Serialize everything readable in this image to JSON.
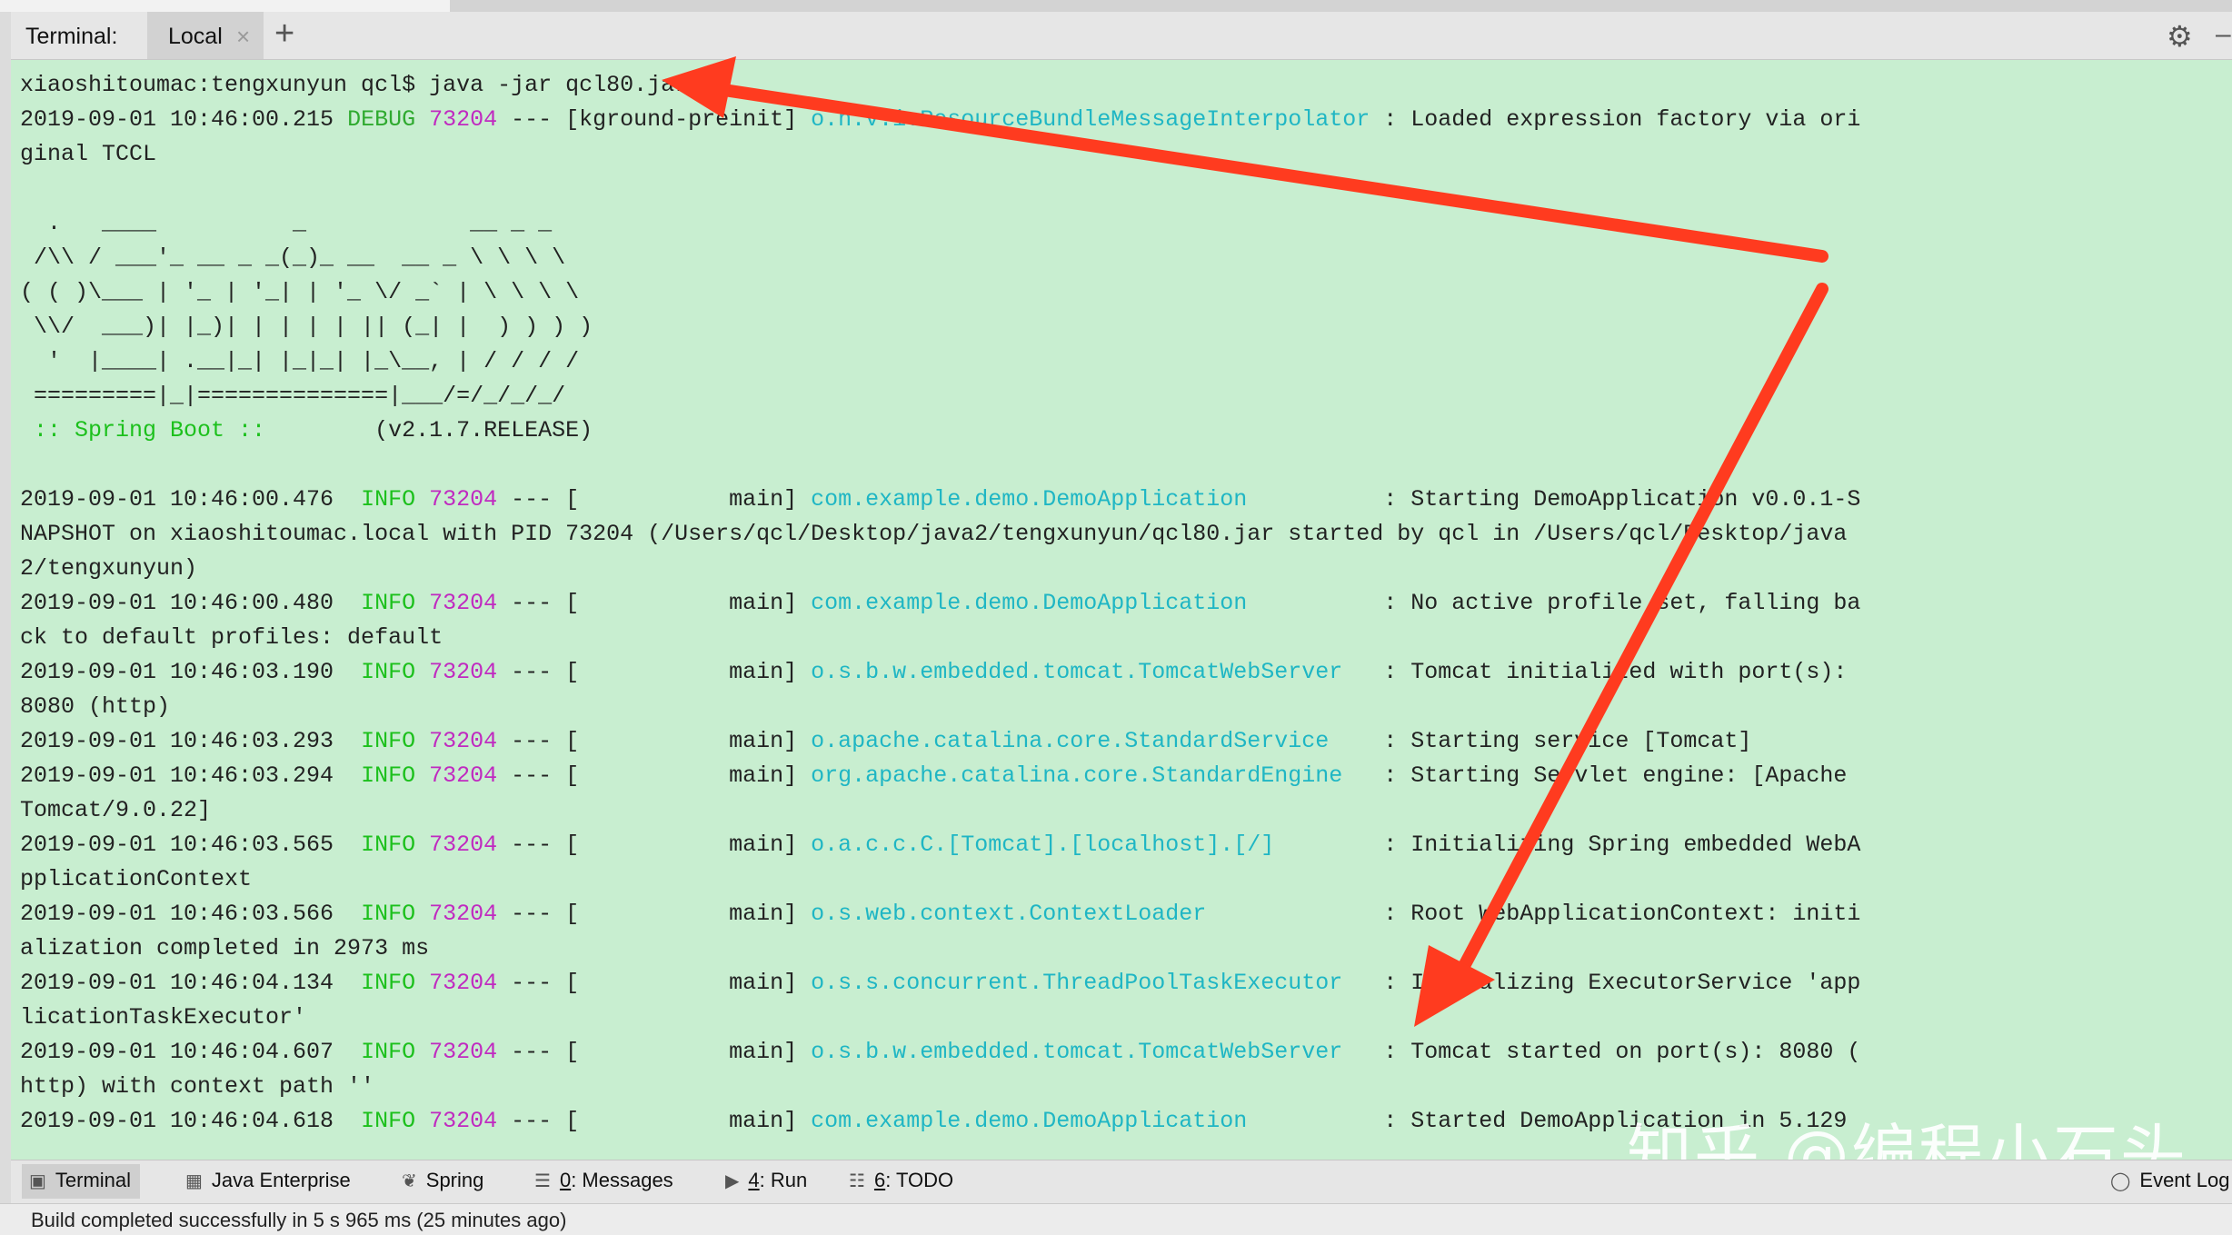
{
  "header": {
    "terminal_label": "Terminal:",
    "tab_local": "Local",
    "tab_close": "×",
    "add_tab": "+",
    "settings_icon": "⚙",
    "minimize": "–"
  },
  "terminal": {
    "lines": [
      [
        {
          "t": "xiaoshitoumac:tengxunyun qcl$ java -jar qcl80.jar"
        }
      ],
      [
        {
          "t": "2019-09-01 10:46:00.215 "
        },
        {
          "t": "DEBUG",
          "c": "c-debug"
        },
        {
          "t": " "
        },
        {
          "t": "73204",
          "c": "c-pid"
        },
        {
          "t": " --- [kground-preinit] "
        },
        {
          "t": "o.h.v.i.ResourceBundleMessageInterpolator",
          "c": "c-log"
        },
        {
          "t": " : Loaded expression factory via ori"
        }
      ],
      [
        {
          "t": "ginal TCCL"
        }
      ],
      [
        {
          "t": ""
        }
      ],
      [
        {
          "t": "  .   ____          _            __ _ _"
        }
      ],
      [
        {
          "t": " /\\\\ / ___'_ __ _ _(_)_ __  __ _ \\ \\ \\ \\"
        }
      ],
      [
        {
          "t": "( ( )\\___ | '_ | '_| | '_ \\/ _` | \\ \\ \\ \\"
        }
      ],
      [
        {
          "t": " \\\\/  ___)| |_)| | | | | || (_| |  ) ) ) )"
        }
      ],
      [
        {
          "t": "  '  |____| .__|_| |_|_| |_\\__, | / / / /"
        }
      ],
      [
        {
          "t": " =========|_|==============|___/=/_/_/_/"
        }
      ],
      [
        {
          "t": " :: Spring Boot ::",
          "c": "c-boot"
        },
        {
          "t": "        (v2.1.7.RELEASE)"
        }
      ],
      [
        {
          "t": ""
        }
      ],
      [
        {
          "t": "2019-09-01 10:46:00.476  "
        },
        {
          "t": "INFO",
          "c": "c-info"
        },
        {
          "t": " "
        },
        {
          "t": "73204",
          "c": "c-pid"
        },
        {
          "t": " --- [           main] "
        },
        {
          "t": "com.example.demo.DemoApplication",
          "c": "c-log"
        },
        {
          "t": "          : Starting DemoApplication v0.0.1-S"
        }
      ],
      [
        {
          "t": "NAPSHOT on xiaoshitoumac.local with PID 73204 (/Users/qcl/Desktop/java2/tengxunyun/qcl80.jar started by qcl in /Users/qcl/Desktop/java"
        }
      ],
      [
        {
          "t": "2/tengxunyun)"
        }
      ],
      [
        {
          "t": "2019-09-01 10:46:00.480  "
        },
        {
          "t": "INFO",
          "c": "c-info"
        },
        {
          "t": " "
        },
        {
          "t": "73204",
          "c": "c-pid"
        },
        {
          "t": " --- [           main] "
        },
        {
          "t": "com.example.demo.DemoApplication",
          "c": "c-log"
        },
        {
          "t": "          : No active profile set, falling ba"
        }
      ],
      [
        {
          "t": "ck to default profiles: default"
        }
      ],
      [
        {
          "t": "2019-09-01 10:46:03.190  "
        },
        {
          "t": "INFO",
          "c": "c-info"
        },
        {
          "t": " "
        },
        {
          "t": "73204",
          "c": "c-pid"
        },
        {
          "t": " --- [           main] "
        },
        {
          "t": "o.s.b.w.embedded.tomcat.TomcatWebServer",
          "c": "c-log"
        },
        {
          "t": "   : Tomcat initialized with port(s):"
        }
      ],
      [
        {
          "t": "8080 (http)"
        }
      ],
      [
        {
          "t": "2019-09-01 10:46:03.293  "
        },
        {
          "t": "INFO",
          "c": "c-info"
        },
        {
          "t": " "
        },
        {
          "t": "73204",
          "c": "c-pid"
        },
        {
          "t": " --- [           main] "
        },
        {
          "t": "o.apache.catalina.core.StandardService",
          "c": "c-log"
        },
        {
          "t": "    : Starting service [Tomcat]"
        }
      ],
      [
        {
          "t": "2019-09-01 10:46:03.294  "
        },
        {
          "t": "INFO",
          "c": "c-info"
        },
        {
          "t": " "
        },
        {
          "t": "73204",
          "c": "c-pid"
        },
        {
          "t": " --- [           main] "
        },
        {
          "t": "org.apache.catalina.core.StandardEngine",
          "c": "c-log"
        },
        {
          "t": "   : Starting Servlet engine: [Apache"
        }
      ],
      [
        {
          "t": "Tomcat/9.0.22]"
        }
      ],
      [
        {
          "t": "2019-09-01 10:46:03.565  "
        },
        {
          "t": "INFO",
          "c": "c-info"
        },
        {
          "t": " "
        },
        {
          "t": "73204",
          "c": "c-pid"
        },
        {
          "t": " --- [           main] "
        },
        {
          "t": "o.a.c.c.C.[Tomcat].[localhost].[/]",
          "c": "c-log"
        },
        {
          "t": "        : Initializing Spring embedded WebA"
        }
      ],
      [
        {
          "t": "pplicationContext"
        }
      ],
      [
        {
          "t": "2019-09-01 10:46:03.566  "
        },
        {
          "t": "INFO",
          "c": "c-info"
        },
        {
          "t": " "
        },
        {
          "t": "73204",
          "c": "c-pid"
        },
        {
          "t": " --- [           main] "
        },
        {
          "t": "o.s.web.context.ContextLoader",
          "c": "c-log"
        },
        {
          "t": "             : Root WebApplicationContext: initi"
        }
      ],
      [
        {
          "t": "alization completed in 2973 ms"
        }
      ],
      [
        {
          "t": "2019-09-01 10:46:04.134  "
        },
        {
          "t": "INFO",
          "c": "c-info"
        },
        {
          "t": " "
        },
        {
          "t": "73204",
          "c": "c-pid"
        },
        {
          "t": " --- [           main] "
        },
        {
          "t": "o.s.s.concurrent.ThreadPoolTaskExecutor",
          "c": "c-log"
        },
        {
          "t": "   : Initializing ExecutorService 'app"
        }
      ],
      [
        {
          "t": "licationTaskExecutor'"
        }
      ],
      [
        {
          "t": "2019-09-01 10:46:04.607  "
        },
        {
          "t": "INFO",
          "c": "c-info"
        },
        {
          "t": " "
        },
        {
          "t": "73204",
          "c": "c-pid"
        },
        {
          "t": " --- [           main] "
        },
        {
          "t": "o.s.b.w.embedded.tomcat.TomcatWebServer",
          "c": "c-log"
        },
        {
          "t": "   : Tomcat started on port(s): 8080 ("
        }
      ],
      [
        {
          "t": "http) with context path ''"
        }
      ],
      [
        {
          "t": "2019-09-01 10:46:04.618  "
        },
        {
          "t": "INFO",
          "c": "c-info"
        },
        {
          "t": " "
        },
        {
          "t": "73204",
          "c": "c-pid"
        },
        {
          "t": " --- [           main] "
        },
        {
          "t": "com.example.demo.DemoApplication",
          "c": "c-log"
        },
        {
          "t": "          : Started DemoApplication in 5.129"
        }
      ]
    ]
  },
  "watermark": "知乎 @编程小石头",
  "toolbar": {
    "terminal": "Terminal",
    "java_enterprise": "Java Enterprise",
    "spring": "Spring",
    "messages_key": "0",
    "messages": ": Messages",
    "run_key": "4",
    "run": ": Run",
    "todo_key": "6",
    "todo": ": TODO",
    "event_log": "Event Log"
  },
  "status": {
    "text": "Build completed successfully in 5 s 965 ms (25 minutes ago)"
  },
  "colors": {
    "terminal_bg": "#c8eed0",
    "arrow": "#ff3b1f",
    "info": "#1cc01c",
    "pid": "#c02ac0",
    "logger": "#1fb6c4"
  }
}
